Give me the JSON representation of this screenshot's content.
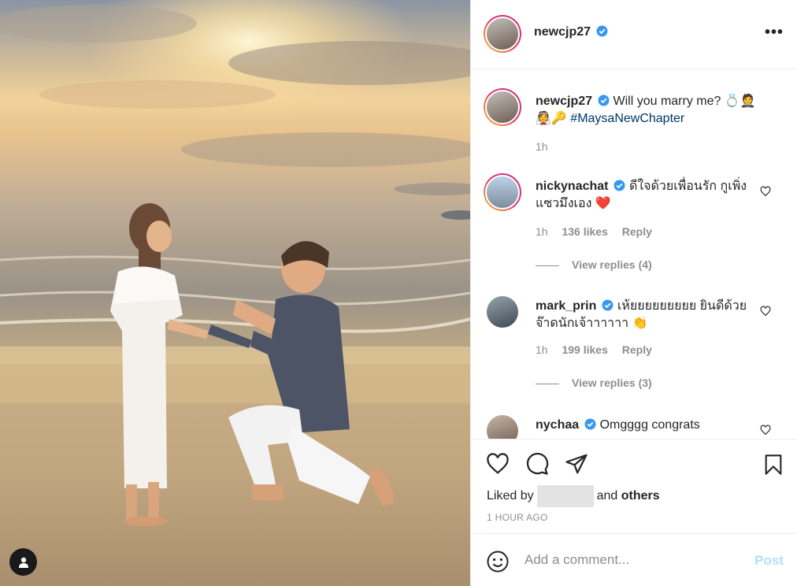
{
  "post": {
    "author": "newcjp27",
    "author_verified": true
  },
  "header": {
    "username": "newcjp27",
    "more_label": "•••"
  },
  "caption": {
    "username": "newcjp27",
    "text": "Will you marry me? 💍🤵",
    "text2": "👰🔑",
    "hashtag": "#MaysaNewChapter",
    "time": "1h"
  },
  "comments": [
    {
      "username": "nickynachat",
      "text": "ดีใจด้วยเพื่อนรัก กูเพิ่งแซวมึงเอง ❤️",
      "time": "1h",
      "likes": "136 likes",
      "reply_label": "Reply",
      "view_replies": "View replies (4)"
    },
    {
      "username": "mark_prin",
      "text": "เห้ยยยยยยยยย ยินดีด้วยจ๊าดนักเจ้าาาาาา 👏",
      "time": "1h",
      "likes": "199 likes",
      "reply_label": "Reply",
      "view_replies": "View replies (3)"
    },
    {
      "username": "nychaa",
      "text": "Omgggg congrats"
    }
  ],
  "actions": {
    "liked_by_prefix": "Liked by",
    "liked_by_suffix": "and",
    "liked_by_others": "others",
    "timestamp": "1 HOUR AGO"
  },
  "add_comment": {
    "placeholder": "Add a comment...",
    "post_label": "Post"
  },
  "colors": {
    "verified": "#3897f0",
    "link": "#00376b",
    "muted": "#8e8e8e",
    "heart_emoji": "#e0245e",
    "post_disabled": "#b2dffc"
  },
  "icons": [
    "heart-icon",
    "comment-icon",
    "share-icon",
    "bookmark-icon",
    "emoji-icon",
    "verified-badge-icon",
    "more-icon",
    "user-tag-icon"
  ]
}
